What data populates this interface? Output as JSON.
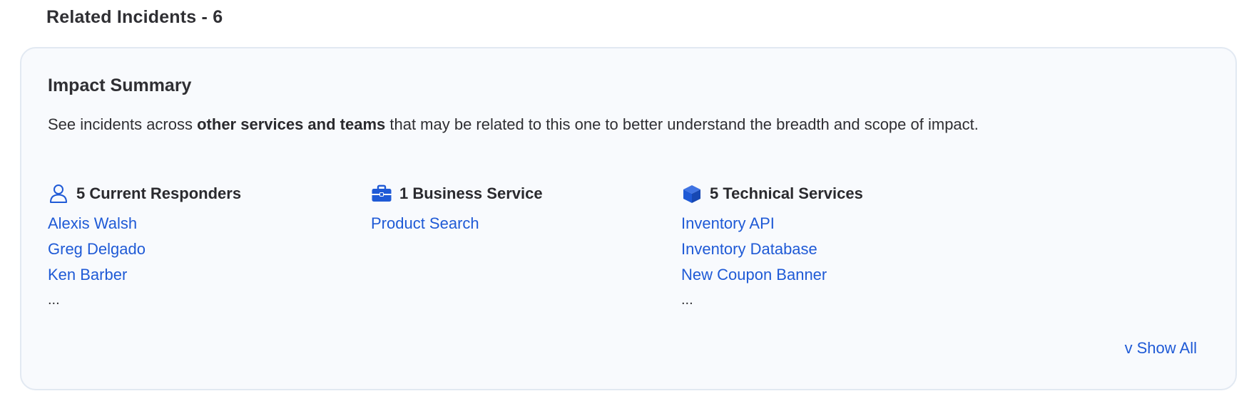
{
  "header": {
    "title": "Related Incidents - 6"
  },
  "impact_summary": {
    "title": "Impact Summary",
    "description_prefix": "See incidents across ",
    "description_bold": "other services and teams",
    "description_suffix": " that may be related to this one to better understand the breadth and scope of impact.",
    "responders": {
      "heading": "5 Current Responders",
      "icon": "user-icon",
      "items": [
        "Alexis Walsh",
        "Greg Delgado",
        "Ken Barber"
      ],
      "more": "..."
    },
    "business_services": {
      "heading": "1 Business Service",
      "icon": "briefcase-icon",
      "items": [
        "Product Search"
      ]
    },
    "technical_services": {
      "heading": "5 Technical Services",
      "icon": "cube-icon",
      "items": [
        "Inventory API",
        "Inventory Database",
        "New Coupon Banner"
      ],
      "more": "..."
    },
    "show_all": {
      "chevron": "v",
      "label": "Show All"
    }
  },
  "colors": {
    "link": "#1f5ad6",
    "card_background": "#f8fafd",
    "card_border": "#e2e9f2",
    "icon_accent": "#1f5ad6"
  }
}
